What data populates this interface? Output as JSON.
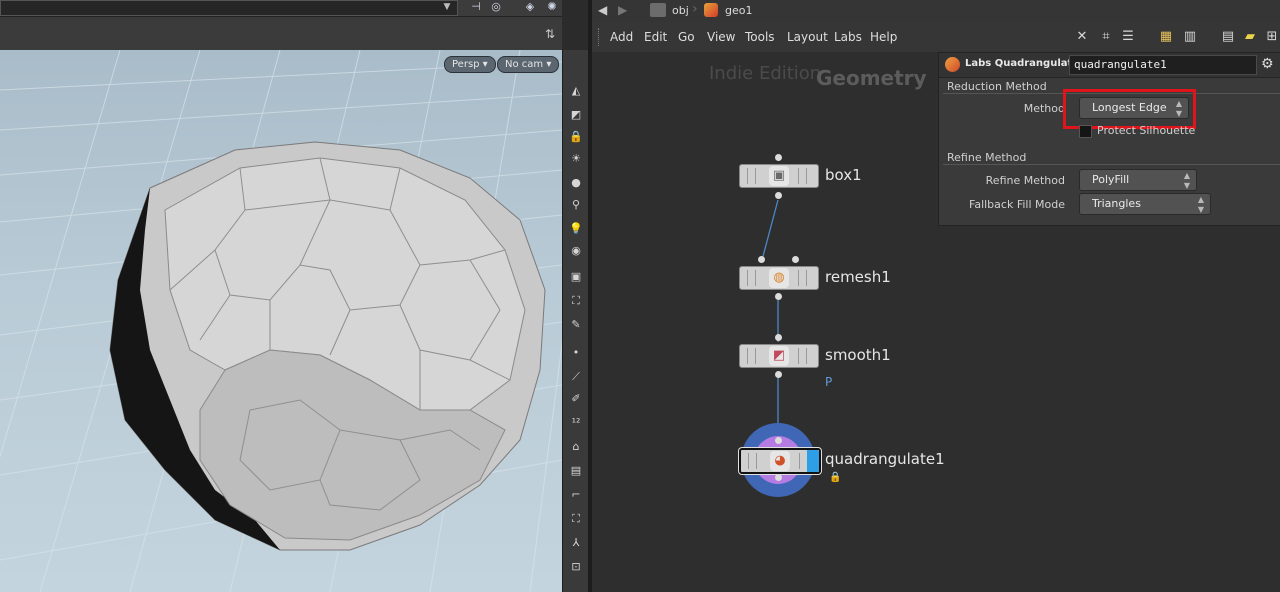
{
  "viewport": {
    "camera_menu": "Persp",
    "cam_menu": "No cam",
    "help_icon": "?"
  },
  "network": {
    "path": [
      "obj",
      "geo1"
    ],
    "menu": [
      "Add",
      "Edit",
      "Go",
      "View",
      "Tools",
      "Layout",
      "Labs",
      "Help"
    ],
    "watermark_edition": "Indie Edition",
    "watermark_context": "Geometry",
    "nodes": [
      {
        "name": "box1",
        "icon": "box-icon"
      },
      {
        "name": "remesh1",
        "icon": "remesh-icon"
      },
      {
        "name": "smooth1",
        "icon": "smooth-icon",
        "flag": "P"
      },
      {
        "name": "quadrangulate1",
        "icon": "quadrangulate-icon"
      }
    ]
  },
  "params": {
    "node_type": "Labs Quadrangulate",
    "node_name": "quadrangulate1",
    "reduction_group": "Reduction Method",
    "method_label": "Method",
    "method_value": "Longest Edge",
    "protect_label": "Protect Silhouette",
    "refine_group": "Refine Method",
    "refine_label": "Refine Method",
    "refine_value": "PolyFill",
    "fallback_label": "Fallback Fill Mode",
    "fallback_value": "Triangles"
  },
  "colors": {
    "highlight": "#e0141b",
    "selection": "#2e9fe6"
  }
}
